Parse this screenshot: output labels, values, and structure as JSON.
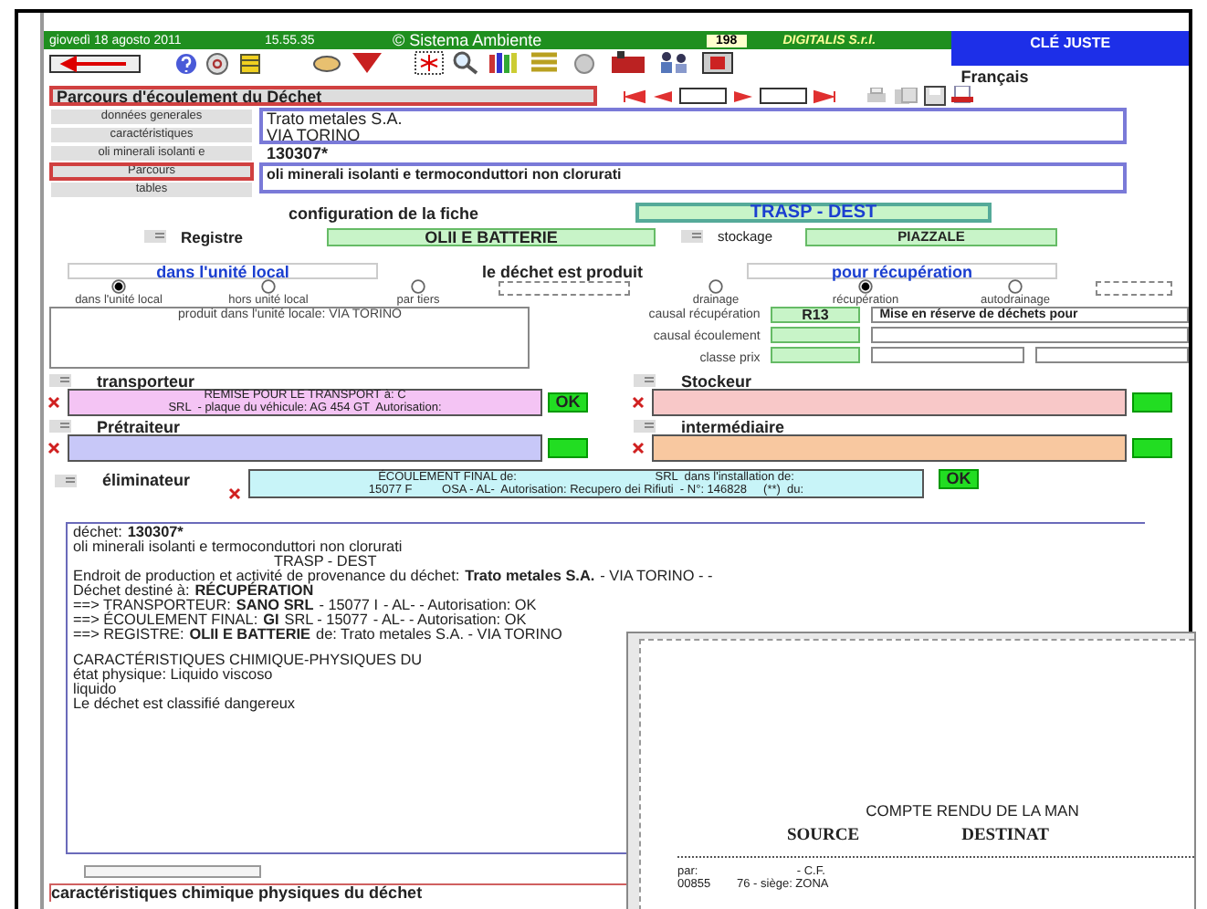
{
  "header": {
    "date": "giovedì 18 agosto 2011",
    "time": "15.55.35",
    "copyright": "© Sistema Ambiente",
    "counter": "198",
    "company": "DIGITALIS S.r.l.",
    "key_label": "CLÉ JUSTE",
    "language": "Français"
  },
  "section_title": "Parcours d'écoulement du Déchet",
  "tabs": [
    {
      "label": "données generales",
      "selected": false
    },
    {
      "label": "caractéristiques",
      "selected": false
    },
    {
      "label": "oli minerali isolanti e",
      "selected": false
    },
    {
      "label": "Parcours",
      "selected": true
    },
    {
      "label": "tables",
      "selected": false
    }
  ],
  "producer": {
    "lines": [
      "Trato metales S.A.",
      "VIA TORINO"
    ]
  },
  "waste_code": "130307*",
  "waste_description": "oli minerali isolanti e termoconduttori non clorurati",
  "config": {
    "label": "configuration de la fiche",
    "value": "TRASP - DEST"
  },
  "registre": {
    "label": "Registre",
    "value": "OLII E BATTERIE"
  },
  "stockage": {
    "label": "stockage",
    "value": "PIAZZALE"
  },
  "production": {
    "left_title": "dans l'unité local",
    "middle_title": "le déchet est produit",
    "right_title": "pour récupération",
    "origin_options": [
      {
        "label": "dans l'unité local",
        "selected": true
      },
      {
        "label": "hors unité local",
        "selected": false
      },
      {
        "label": "par tiers",
        "selected": false
      }
    ],
    "destination_options": [
      {
        "label": "drainage",
        "selected": false
      },
      {
        "label": "récupération",
        "selected": true
      },
      {
        "label": "autodrainage",
        "selected": false
      }
    ],
    "local_note": "produit dans l'unité locale: VIA TORINO"
  },
  "causals": [
    {
      "kind": "single",
      "label": "causal récupération",
      "code": "R13",
      "description": "Mise en réserve de déchets pour"
    },
    {
      "kind": "single",
      "label": "causal écoulement"
    },
    {
      "kind": "split",
      "label": "classe prix"
    }
  ],
  "parties": [
    {
      "label": "transporteur",
      "color": "#f4c4f4",
      "lines": [
        "REMISE POUR LE TRANSPORT à: C",
        "SRL  - plaque du véhicule: AG 454 GT  Autorisation:"
      ],
      "ok": "OK"
    },
    {
      "label": "Stockeur",
      "color": "#f8c8c8"
    },
    {
      "label": "Prétraiteur",
      "color": "#c8c8f8"
    },
    {
      "label": "intermédiaire",
      "color": "#f8c8a0"
    },
    {
      "label": "éliminateur",
      "color": "#c8f4f8",
      "lines": [
        "ÉCOULEMENT FINAL de:                                          SRL  dans l'installation de:",
        "15077 F         OSA - AL-  Autorisation: Recupero dei Rifiuti  - N°: 146828     (**)  du:"
      ],
      "ok": "OK"
    }
  ],
  "summary": [
    [
      {
        "text": "déchet:",
        "bold": false
      },
      {
        "text": "130307*",
        "bold": true
      }
    ],
    [
      {
        "text": "oli minerali isolanti e termoconduttori non clorurati",
        "bold": false
      }
    ],
    [
      {
        "text": "TRASP - DEST",
        "bold": false
      }
    ],
    [
      {
        "text": "Endroit de production et activité de provenance du déchet:",
        "bold": false
      },
      {
        "text": "Trato metales S.A.",
        "bold": true
      },
      {
        "text": "- VIA TORINO -  -",
        "bold": false
      }
    ],
    [
      {
        "text": "Déchet destiné à:",
        "bold": false
      },
      {
        "text": "RÉCUPÉRATION",
        "bold": true
      }
    ],
    [
      {
        "text": "==> TRANSPORTEUR:",
        "bold": false
      },
      {
        "text": "SANO SRL",
        "bold": true
      },
      {
        "text": "- 15077 I",
        "bold": false
      },
      {
        "text": "- AL- - Autorisation: OK",
        "bold": false
      }
    ],
    [
      {
        "text": "==> ÉCOULEMENT FINAL:",
        "bold": false
      },
      {
        "text": "GI",
        "bold": true
      },
      {
        "text": "SRL - 15077",
        "bold": false
      },
      {
        "text": "- AL- - Autorisation: OK",
        "bold": false
      }
    ],
    [
      {
        "text": "==> REGISTRE:",
        "bold": false
      },
      {
        "text": "OLII E BATTERIE",
        "bold": true
      },
      {
        "text": "de: Trato metales S.A. - VIA TORINO",
        "bold": false
      }
    ],
    [
      {
        "text": "CARACTÉRISTIQUES CHIMIQUE-PHYSIQUES DU",
        "bold": false
      }
    ],
    [
      {
        "text": "état physique: Liquido viscoso",
        "bold": false
      }
    ],
    [
      {
        "text": "liquido",
        "bold": false
      }
    ],
    [
      {
        "text": "Le déchet est classifié dangereux",
        "bold": false
      }
    ]
  ],
  "bottom_label": "caractéristiques chimique physiques du déchet",
  "report": {
    "title": "COMPTE RENDU DE LA MAN",
    "columns": [
      "SOURCE",
      "DESTINAT"
    ],
    "lines": [
      "par:                              - C.F.",
      "00855        76 - siège: ZONA"
    ]
  }
}
